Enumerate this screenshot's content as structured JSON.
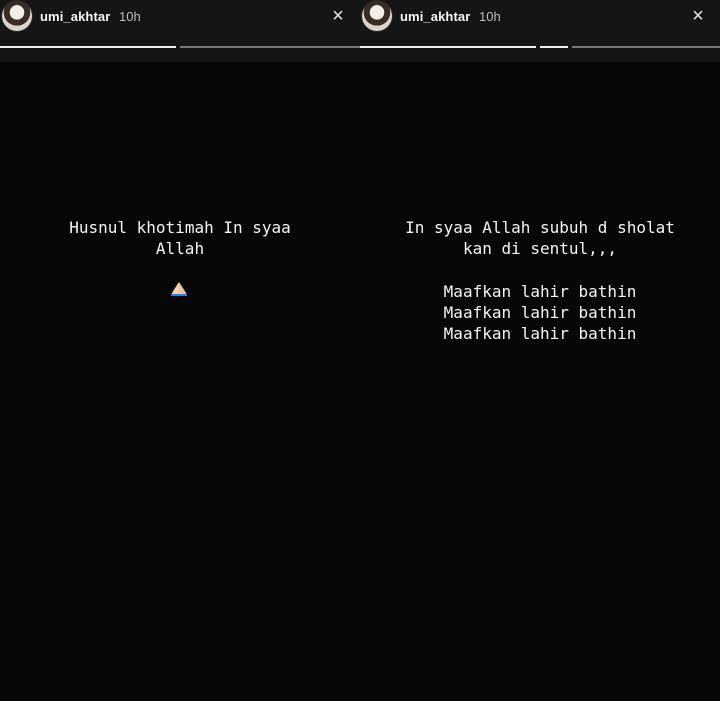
{
  "stories": [
    {
      "username": "umi_akhtar",
      "time": "10h",
      "close_icon": "×",
      "text": "Husnul khotimah In syaa\nAllah",
      "emoji": "folded-hands-icon"
    },
    {
      "username": "umi_akhtar",
      "time": "10h",
      "close_icon": "×",
      "text": "In syaa Allah subuh d sholat\nkan di sentul,,,",
      "text2": "Maafkan lahir bathin\nMaafkan lahir bathin\nMaafkan lahir bathin"
    }
  ],
  "colors": {
    "background": "#070707",
    "header": "#151515",
    "progress_active": "#f0f0f0",
    "progress_inactive": "#777777"
  }
}
